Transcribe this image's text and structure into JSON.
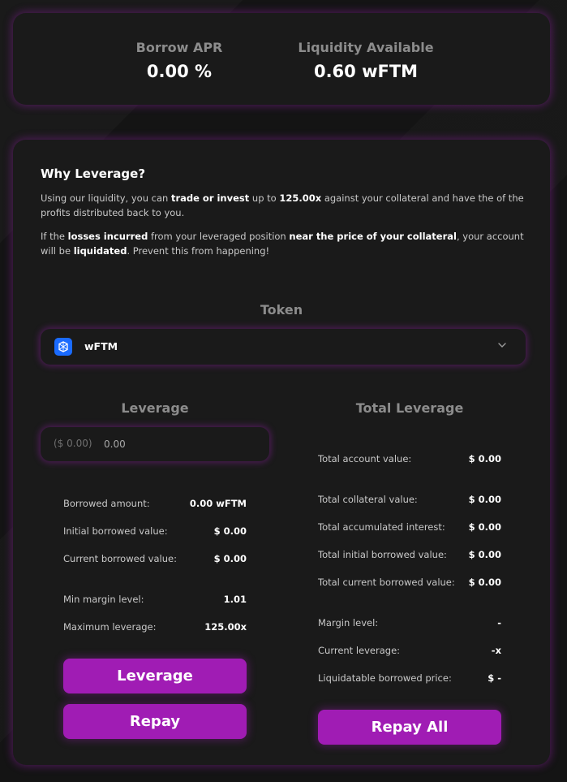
{
  "stats": {
    "borrow_apr_label": "Borrow APR",
    "borrow_apr_value": "0.00 %",
    "liquidity_label": "Liquidity Available",
    "liquidity_value": "0.60 wFTM"
  },
  "info": {
    "title": "Why Leverage?",
    "p1_a": "Using our liquidity, you can ",
    "p1_b": "trade or invest",
    "p1_c": " up to ",
    "p1_d": "125.00x",
    "p1_e": " against your collateral and have the of the profits distributed back to you.",
    "p2_a": "If the ",
    "p2_b": "losses incurred",
    "p2_c": " from your leveraged position ",
    "p2_d": "near the price of your collateral",
    "p2_e": ", your account will be ",
    "p2_f": "liquidated",
    "p2_g": ". Prevent this from happening!"
  },
  "token": {
    "label": "Token",
    "selected": "wFTM",
    "icon": "fantom-token-icon"
  },
  "leverage": {
    "label": "Leverage",
    "usd_prefix": "($ 0.00)",
    "amount_value": "0.00",
    "rows": [
      {
        "label": "Borrowed amount:",
        "value": "0.00 wFTM"
      },
      {
        "label": "Initial borrowed value:",
        "value": "$ 0.00"
      },
      {
        "label": "Current borrowed value:",
        "value": "$ 0.00"
      },
      {
        "label": "Min margin level:",
        "value": "1.01"
      },
      {
        "label": "Maximum leverage:",
        "value": "125.00x"
      }
    ],
    "leverage_button": "Leverage",
    "repay_button": "Repay"
  },
  "total": {
    "label": "Total Leverage",
    "rows": [
      {
        "label": "Total account value:",
        "value": "$ 0.00"
      },
      {
        "label": "Total collateral value:",
        "value": "$ 0.00"
      },
      {
        "label": "Total accumulated interest:",
        "value": "$ 0.00"
      },
      {
        "label": "Total initial borrowed value:",
        "value": "$ 0.00"
      },
      {
        "label": "Total current borrowed value:",
        "value": "$ 0.00"
      },
      {
        "label": "Margin level:",
        "value": "-"
      },
      {
        "label": "Current leverage:",
        "value": "-x"
      },
      {
        "label": "Liquidatable borrowed price:",
        "value": "$ -"
      }
    ],
    "repay_all_button": "Repay All"
  },
  "colors": {
    "accent": "#a01cb4",
    "background": "#141414",
    "card": "#1a1a1a",
    "token_icon": "#1a6bff"
  }
}
